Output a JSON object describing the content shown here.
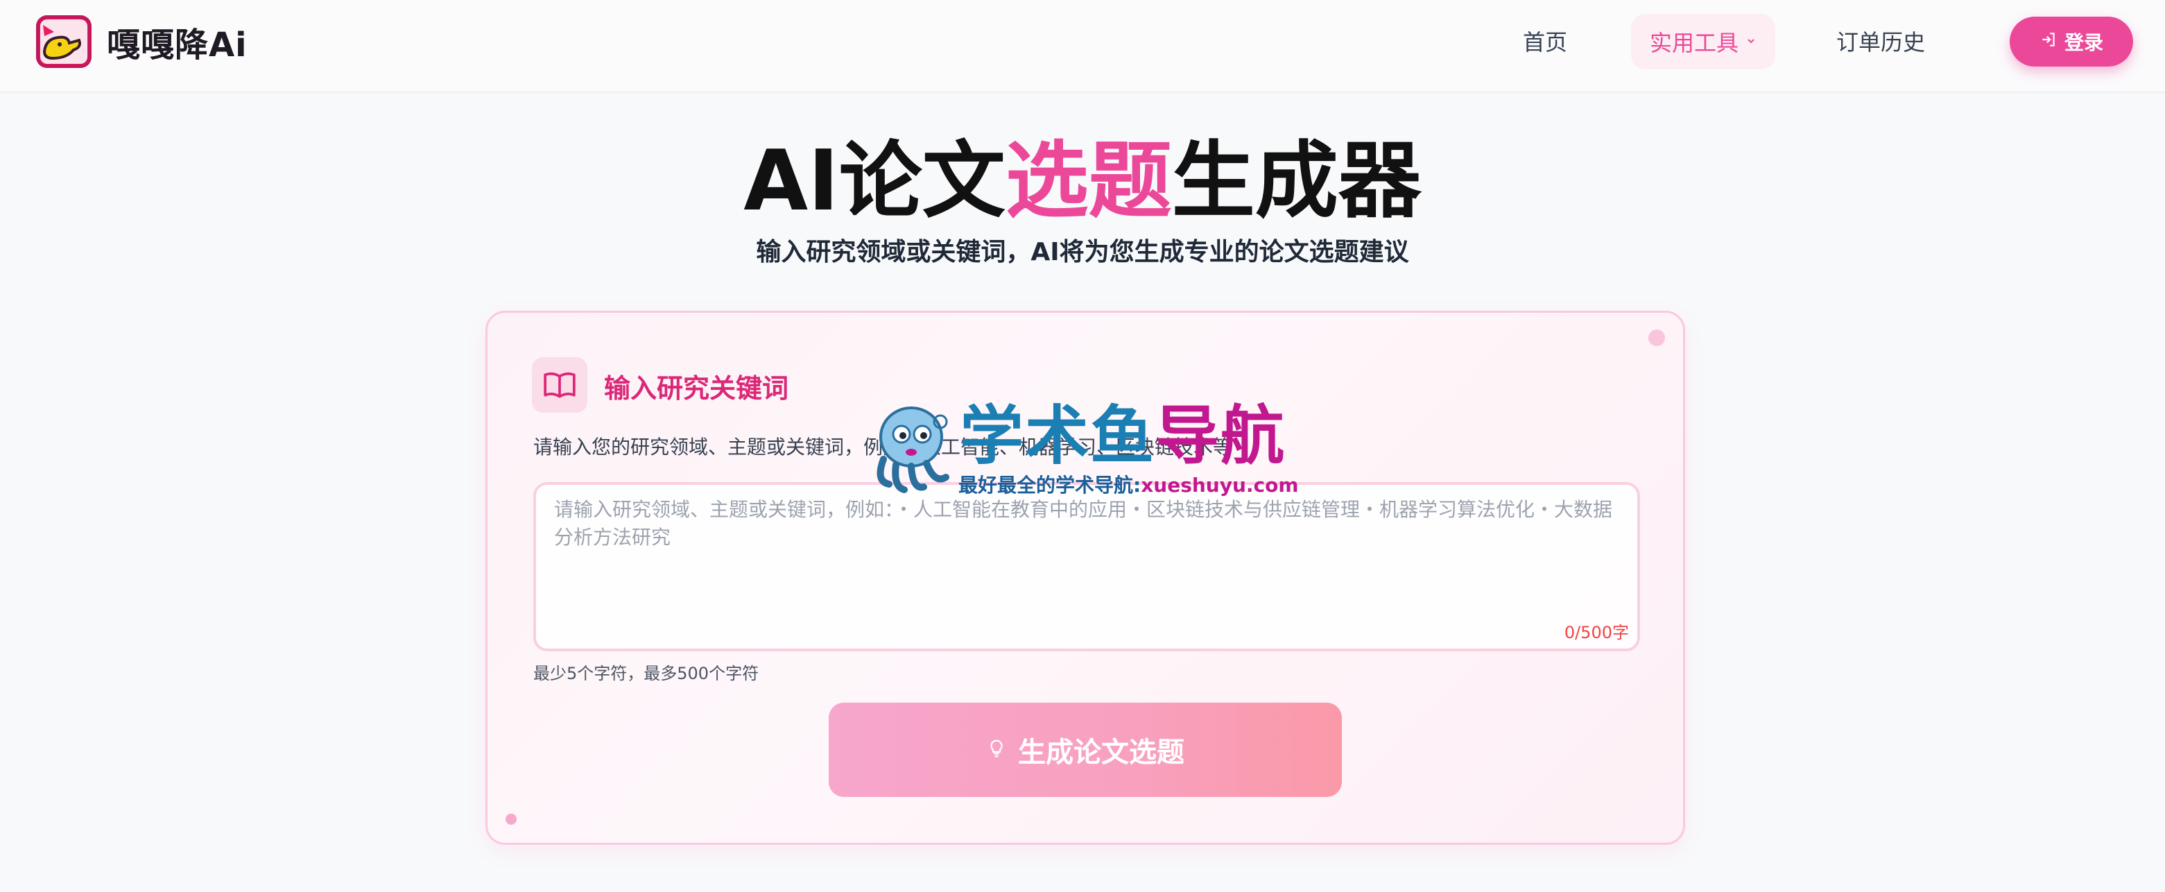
{
  "header": {
    "logo_text": "嘎嘎降Ai",
    "nav": {
      "home": "首页",
      "tools": "实用工具",
      "orders": "订单历史"
    },
    "login_label": "登录"
  },
  "hero": {
    "title_pre": "AI论文",
    "title_accent": "选题",
    "title_post": "生成器",
    "subtitle": "输入研究领域或关键词，AI将为您生成专业的论文选题建议"
  },
  "card": {
    "heading": "输入研究关键词",
    "description": "请输入您的研究领域、主题或关键词，例如：人工智能、机器学习、区块链技术等",
    "textarea": {
      "value": "",
      "placeholder": "请输入研究领域、主题或关键词，例如：・人工智能在教育中的应用・区块链技术与供应链管理・机器学习算法优化・大数据分析方法研究",
      "char_count": "0/500字"
    },
    "hint": "最少5个字符，最多500个字符",
    "generate_label": "生成论文选题"
  },
  "watermark": {
    "title_main": "学术鱼",
    "title_accent": "导航",
    "subtitle": "最好最全的学术导航:",
    "url": "xueshuyu.com"
  },
  "colors": {
    "accent": "#ec4899",
    "accent_dark": "#db2777",
    "card_border": "#fbc8de",
    "count_red": "#ef4444"
  },
  "icons": {
    "logo": "duck-logo-icon",
    "tools_dropdown": "chevron-down-icon",
    "login": "login-arrow-icon",
    "card": "open-book-icon",
    "generate": "lightbulb-icon",
    "watermark": "octopus-mascot-icon"
  }
}
